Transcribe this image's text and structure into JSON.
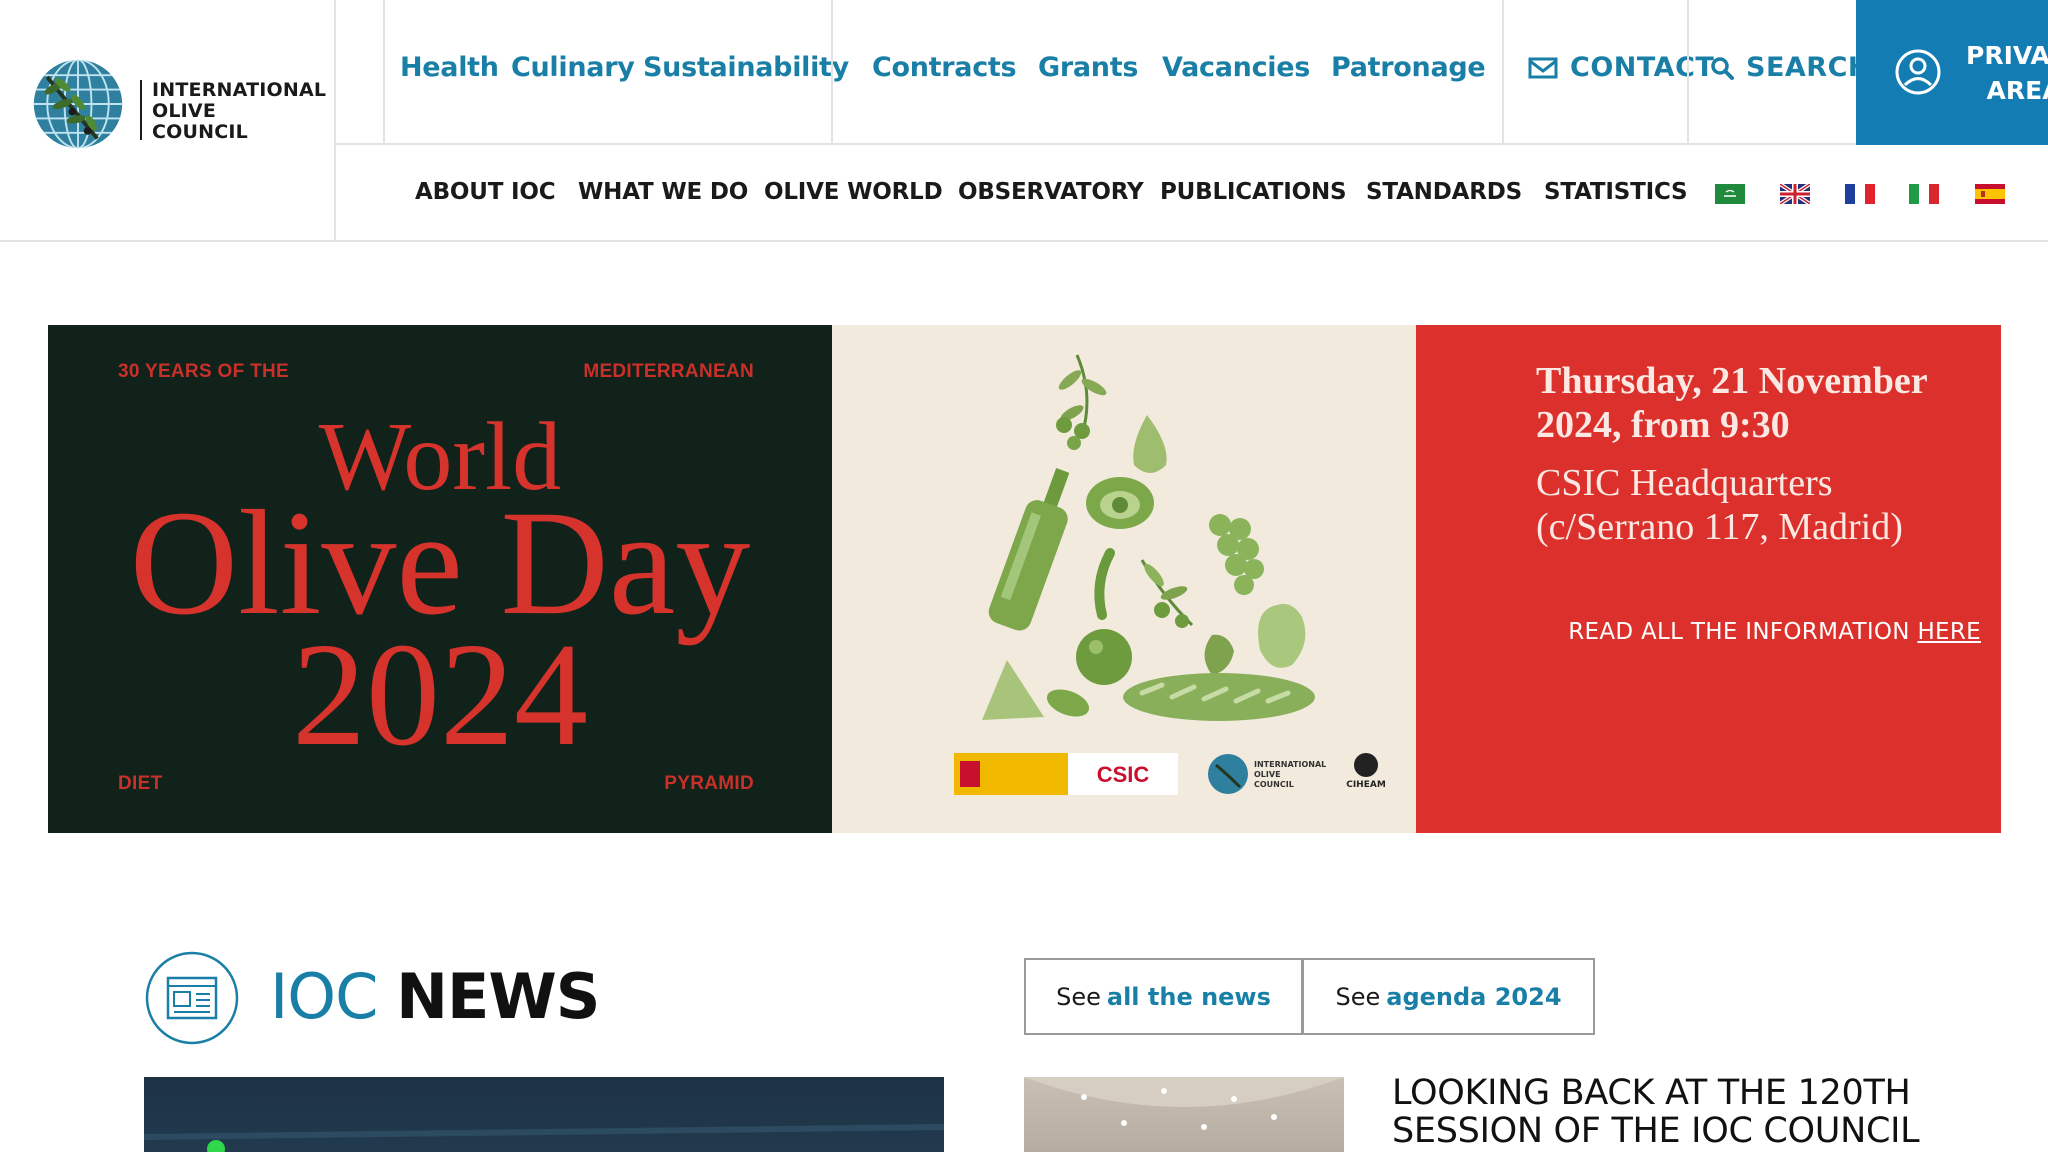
{
  "logo": {
    "lines": [
      "INTERNATIONAL",
      "OLIVE",
      "COUNCIL"
    ],
    "icon": "globe-olive-branch-icon"
  },
  "top_links": [
    "Health",
    "Culinary",
    "Sustainability",
    "Contracts",
    "Grants",
    "Vacancies",
    "Patronage"
  ],
  "contact": {
    "label": "CONTACT",
    "icon": "mail-icon"
  },
  "search": {
    "label": "SEARCH",
    "icon": "search-icon"
  },
  "private_area": {
    "line1": "PRIVATE",
    "line2": "AREA",
    "icon": "user-circle-icon"
  },
  "main_nav": [
    "ABOUT IOC",
    "WHAT WE DO",
    "OLIVE WORLD",
    "OBSERVATORY",
    "PUBLICATIONS",
    "STANDARDS",
    "STATISTICS"
  ],
  "languages": [
    "arabic-flag-icon",
    "uk-flag-icon",
    "france-flag-icon",
    "italy-flag-icon",
    "spain-flag-icon"
  ],
  "banner": {
    "corner_tl": "30 YEARS OF THE",
    "corner_tr": "MEDITERRANEAN",
    "corner_bl": "DIET",
    "corner_br": "PYRAMID",
    "title_line1": "World",
    "title_line2": "Olive Day",
    "title_line3": "2024",
    "date_line1": "Thursday, 21 November",
    "date_line2": "2024, from 9:30",
    "place_line1": "CSIC Headquarters",
    "place_line2": "(c/Serrano 117, Madrid)",
    "read_prefix": "READ ALL THE INFORMATION",
    "read_link": "HERE",
    "sponsors": {
      "csic": "CSIC",
      "ioc": [
        "INTERNATIONAL",
        "OLIVE",
        "COUNCIL"
      ],
      "ciheam": "CIHEAM"
    }
  },
  "news": {
    "title_light": "IOC",
    "title_bold": "NEWS",
    "btn_all_prefix": "See",
    "btn_all_link": "all the news",
    "btn_agenda_prefix": "See",
    "btn_agenda_link": "agenda 2024",
    "headline_line1": "LOOKING BACK AT THE 120TH",
    "headline_line2": "SESSION OF THE IOC COUNCIL"
  },
  "colors": {
    "brand_blue": "#1a7fa6",
    "private_blue": "#137cb2",
    "banner_dark": "#10221a",
    "banner_cream": "#f2ebdd",
    "banner_red": "#db302b"
  }
}
